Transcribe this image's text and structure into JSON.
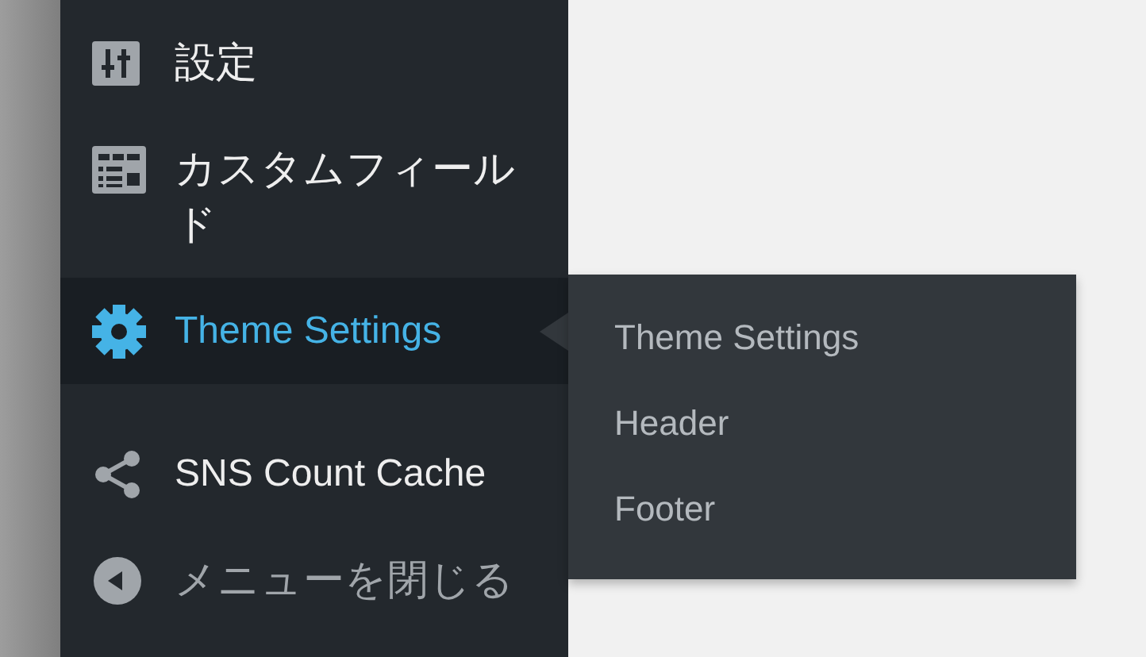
{
  "sidebar": {
    "groups": [
      [
        {
          "label": "設定",
          "selected": false
        },
        {
          "label": "カスタムフィールド",
          "selected": false
        },
        {
          "label": "Theme Settings",
          "selected": true,
          "submenu": [
            {
              "label": "Theme Settings"
            },
            {
              "label": "Header"
            },
            {
              "label": "Footer"
            }
          ]
        }
      ],
      [
        {
          "label": "SNS Count Cache",
          "selected": false
        }
      ]
    ],
    "collapse_button": {
      "label": "メニューを閉じる"
    }
  }
}
